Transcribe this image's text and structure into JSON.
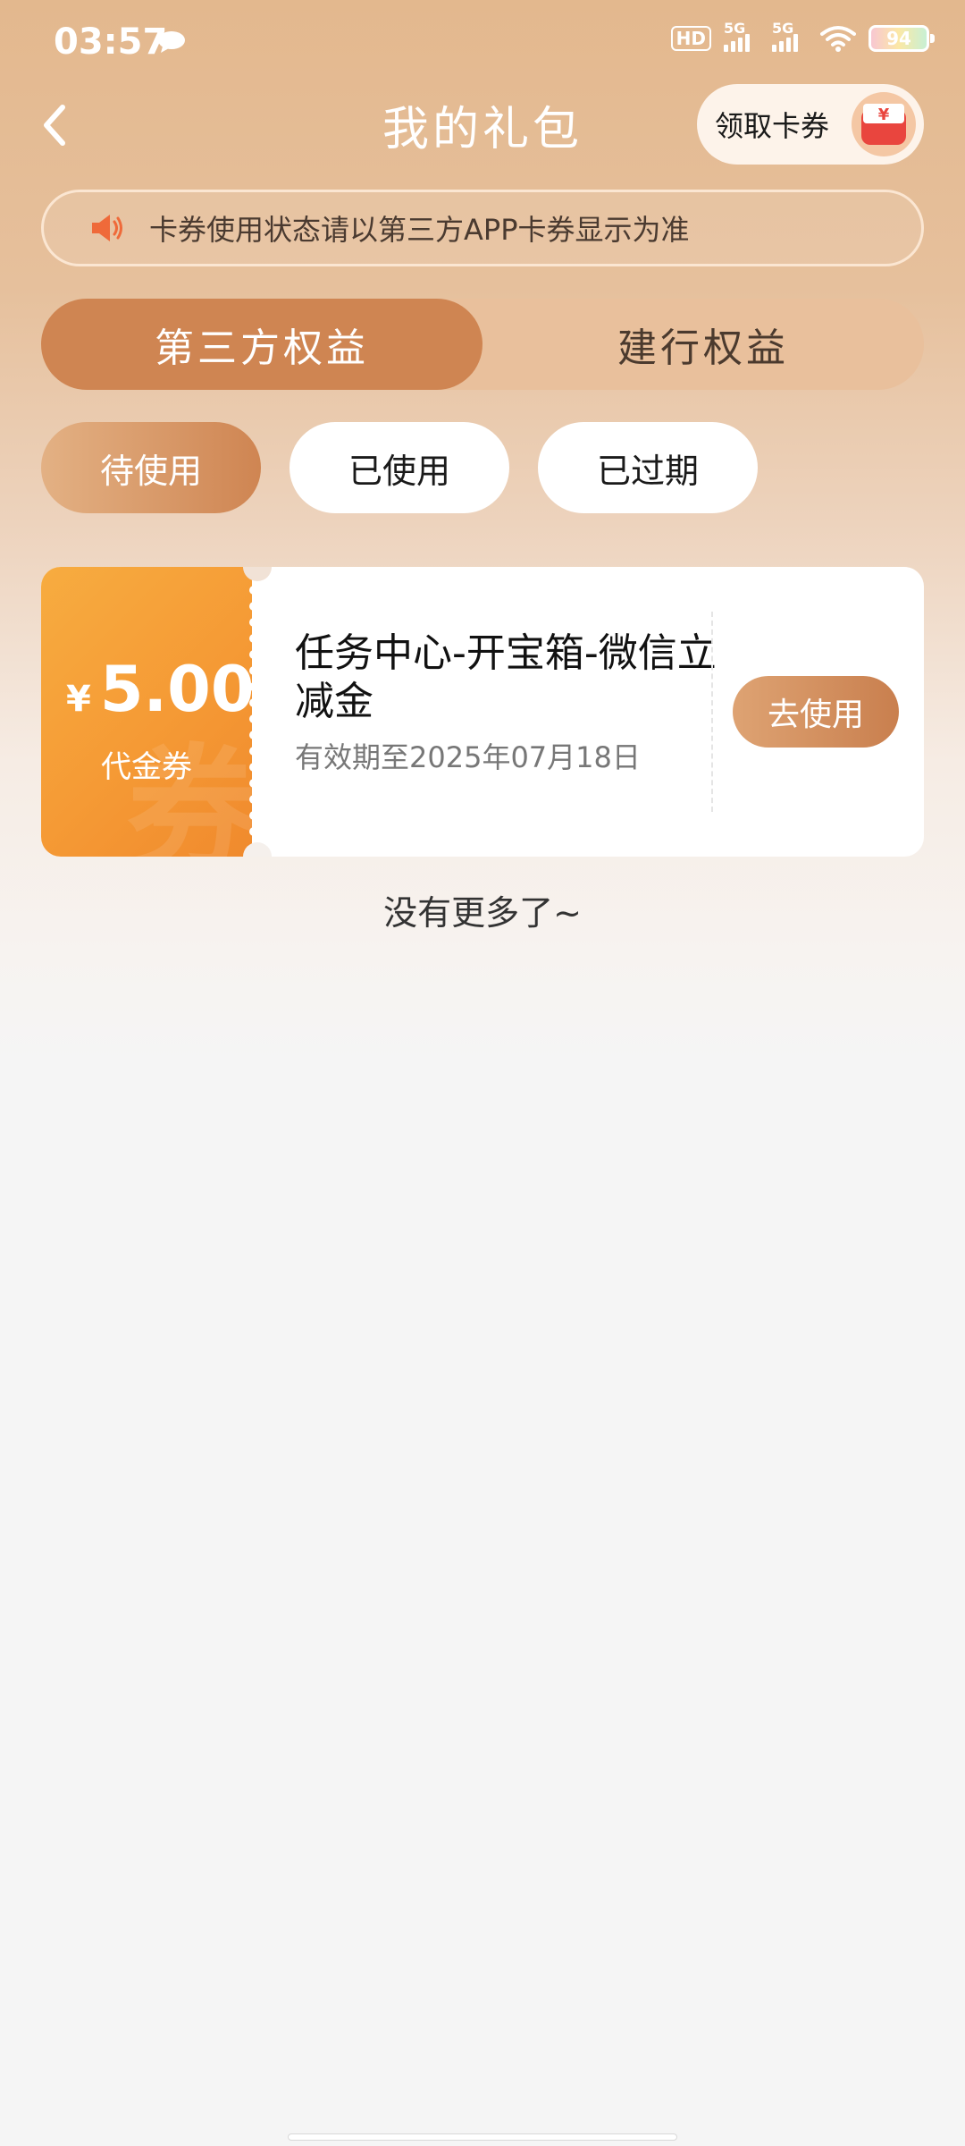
{
  "status_bar": {
    "time": "03:57",
    "hd_label": "HD",
    "signal_1_label": "5G",
    "signal_2_label": "5G",
    "battery": "94"
  },
  "header": {
    "title": "我的礼包",
    "claim_label": "领取卡券",
    "claim_icon_symbol": "¥"
  },
  "notice": {
    "text": "卡券使用状态请以第三方APP卡券显示为准"
  },
  "tabs": [
    {
      "label": "第三方权益",
      "active": true
    },
    {
      "label": "建行权益",
      "active": false
    }
  ],
  "filters": [
    {
      "label": "待使用",
      "active": true
    },
    {
      "label": "已使用",
      "active": false
    },
    {
      "label": "已过期",
      "active": false
    }
  ],
  "coupon": {
    "currency": "¥",
    "amount": "5.00",
    "type": "代金券",
    "watermark": "券",
    "title": "任务中心-开宝箱-微信立减金",
    "expiry": "有效期至2025年07月18日",
    "button_label": "去使用"
  },
  "footer": {
    "no_more": "没有更多了~"
  },
  "colors": {
    "accent": "#cf8552",
    "coupon_orange": "#f59a35",
    "background": "#f5f5f5"
  }
}
